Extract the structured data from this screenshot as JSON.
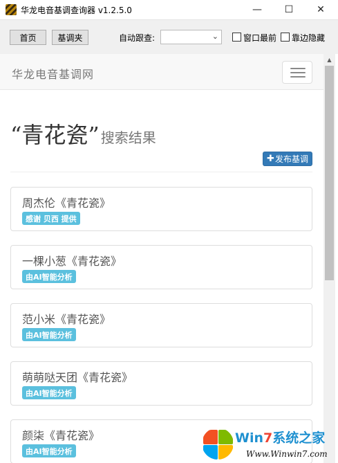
{
  "window": {
    "title": "华龙电音基调查询器 v1.2.5.0",
    "controls": {
      "minimize": "—",
      "maximize": "☐",
      "close": "✕"
    }
  },
  "toolbar": {
    "home_label": "首页",
    "basefolder_label": "基调夹",
    "auto_follow_label": "自动跟查:",
    "auto_follow_value": "",
    "topmost_label": "窗口最前",
    "topmost_checked": false,
    "edge_hide_label": "靠边隐藏",
    "edge_hide_checked": false
  },
  "site": {
    "brand": "华龙电音基调网",
    "menu_icon": "hamburger-menu-icon"
  },
  "search": {
    "query": "“青花瓷”",
    "suffix": "搜索结果",
    "publish_label": "发布基调",
    "publish_icon": "plus-icon"
  },
  "results": [
    {
      "title": "周杰伦《青花瓷》",
      "badge": "感谢 贝西 提供"
    },
    {
      "title": "一棵小葱《青花瓷》",
      "badge": "由AI智能分析"
    },
    {
      "title": "范小米《青花瓷》",
      "badge": "由AI智能分析"
    },
    {
      "title": "萌萌哒天团《青花瓷》",
      "badge": "由AI智能分析"
    },
    {
      "title": "颜柒《青花瓷》",
      "badge": "由AI智能分析"
    }
  ],
  "watermark": {
    "title_prefix": "Win",
    "title_seven": "7",
    "title_suffix": "系统之家",
    "url": "Www.Winwin7.com"
  },
  "colors": {
    "primary": "#337ab7",
    "info_badge": "#5bc0de",
    "navbar_bg": "#f8f8f8",
    "toolbar_bg": "#f0f0f0"
  }
}
